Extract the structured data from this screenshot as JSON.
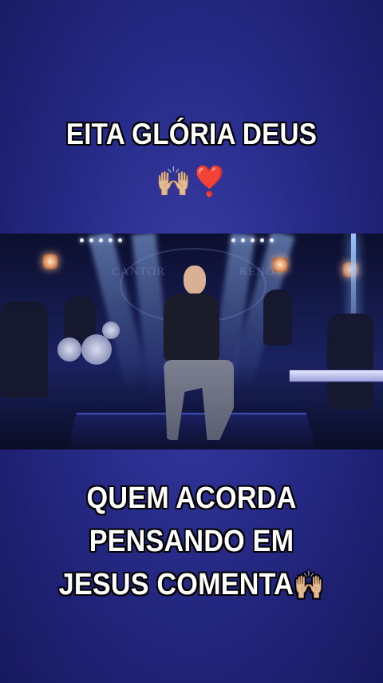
{
  "captions": {
    "top": "EITA GLÓRIA DEUS",
    "top_emoji": "🙌🏼❣️",
    "bottom_lines": [
      "QUEM ACORDA",
      "PENSANDO EM",
      "JESUS COMENTA"
    ],
    "bottom_emoji": "🙌🏼"
  },
  "video": {
    "watermark_left": "CANTOR",
    "watermark_right": "RENO"
  },
  "colors": {
    "background": "#2b2f8f",
    "caption_text": "#ffffff",
    "caption_outline": "#000000"
  }
}
